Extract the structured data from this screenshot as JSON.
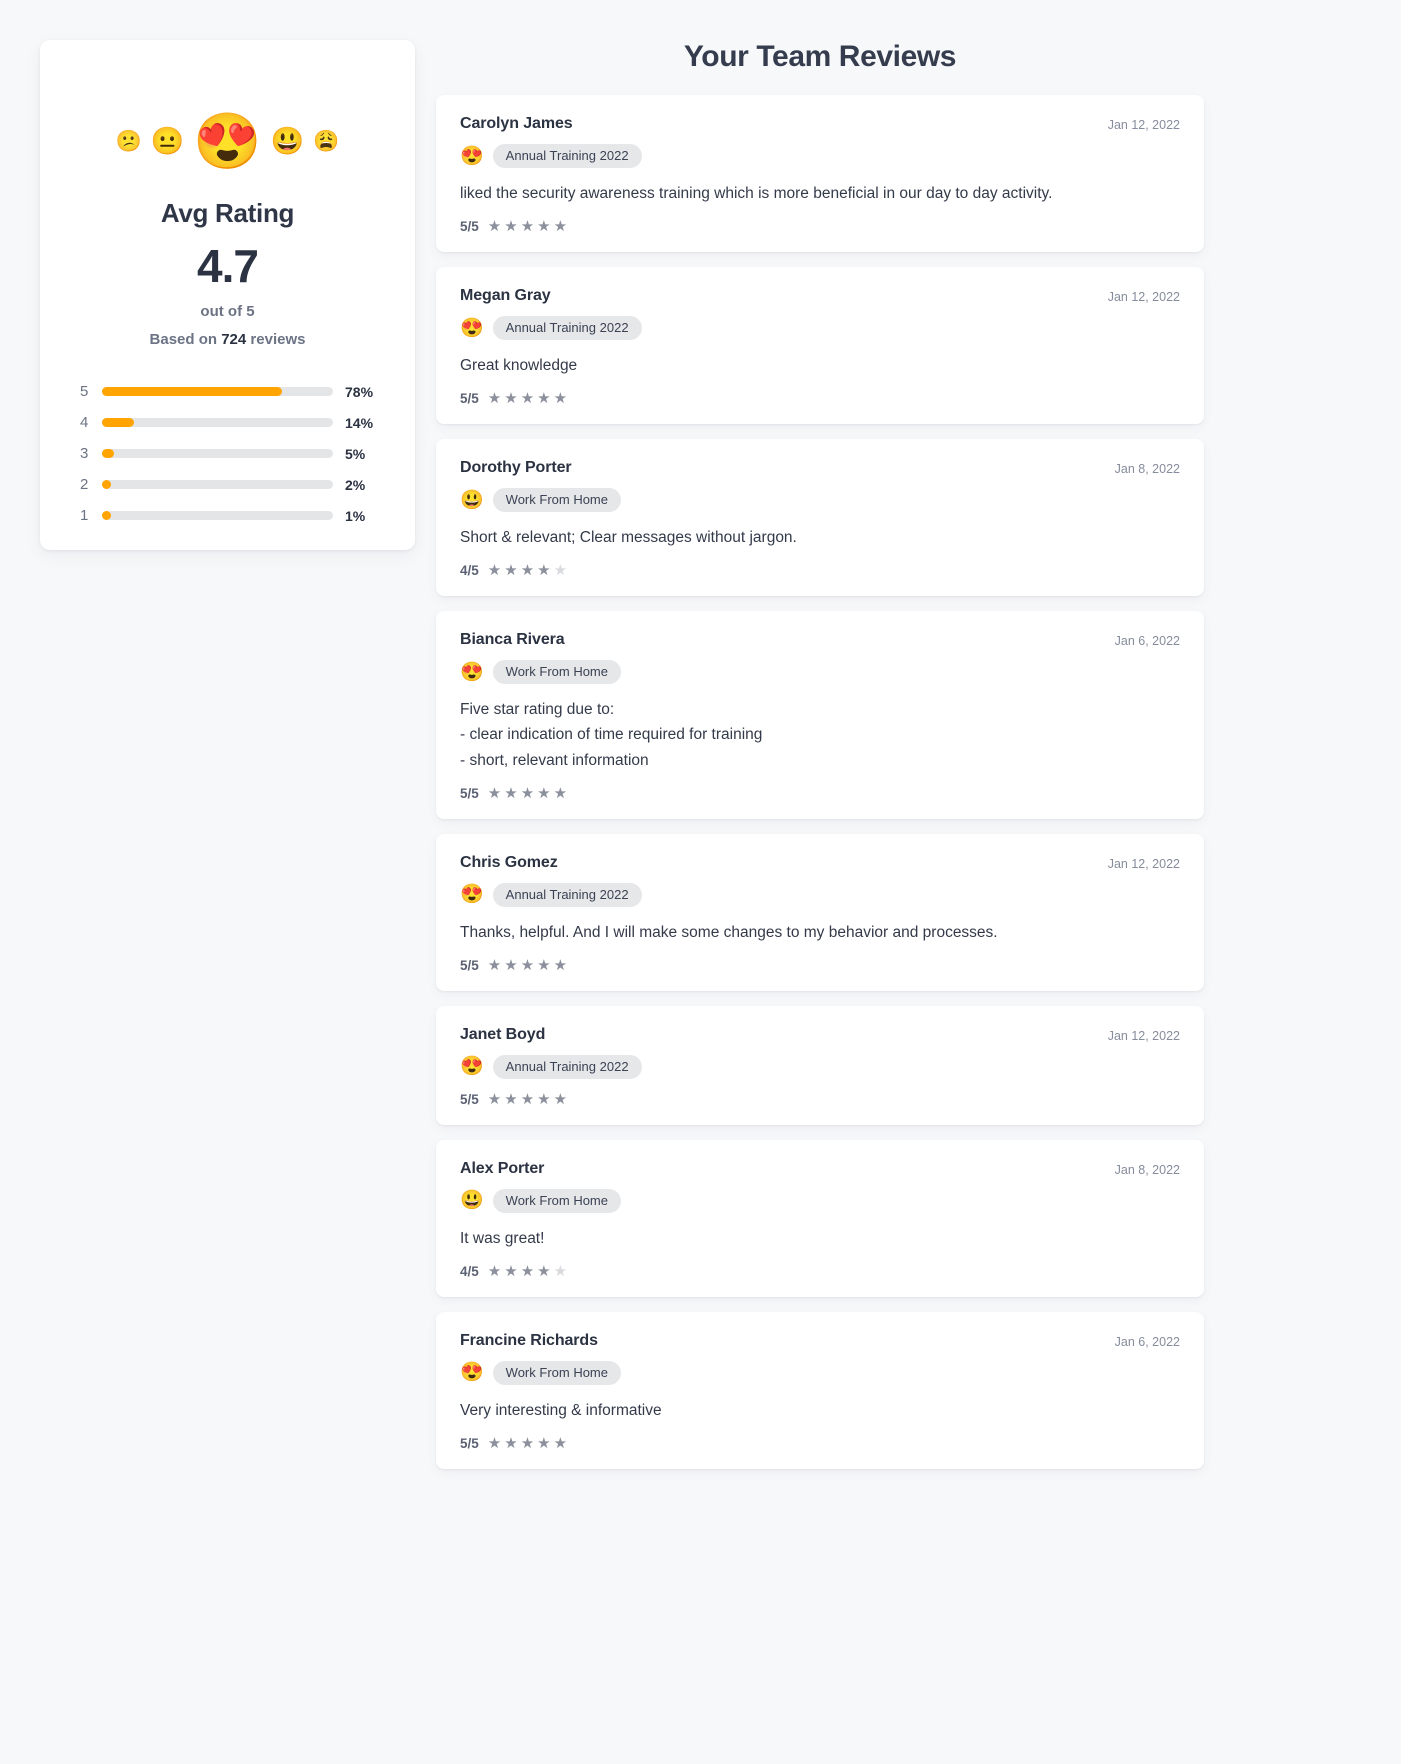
{
  "summary": {
    "emoji_row": [
      {
        "name": "confused-face-emoji",
        "glyph": "😕",
        "size": "small"
      },
      {
        "name": "neutral-face-emoji",
        "glyph": "😐",
        "size": "medium"
      },
      {
        "name": "heart-eyes-emoji",
        "glyph": "😍",
        "size": "large"
      },
      {
        "name": "slightly-smiling-face-emoji",
        "glyph": "😃",
        "size": "medium"
      },
      {
        "name": "weary-face-emoji",
        "glyph": "😩",
        "size": "small"
      }
    ],
    "title": "Avg Rating",
    "value": "4.7",
    "out_of": "out of 5",
    "based_on_prefix": "Based on ",
    "based_on_count": "724",
    "based_on_suffix": " reviews",
    "accent_color": "#ffa400",
    "track_color": "#e4e5e7",
    "distribution": [
      {
        "label": "5",
        "pct": 78,
        "pct_text": "78%"
      },
      {
        "label": "4",
        "pct": 14,
        "pct_text": "14%"
      },
      {
        "label": "3",
        "pct": 5,
        "pct_text": "5%"
      },
      {
        "label": "2",
        "pct": 2,
        "pct_text": "2%"
      },
      {
        "label": "1",
        "pct": 1,
        "pct_text": "1%"
      }
    ]
  },
  "header": {
    "title": "Your Team Reviews"
  },
  "reviews": [
    {
      "name": "Carolyn James",
      "date": "Jan 12, 2022",
      "emoji": "😍",
      "emoji_name": "heart-eyes-emoji",
      "tag": "Annual Training 2022",
      "body": "liked the security awareness training which is more beneficial in our day to day activity.",
      "score": "5/5",
      "stars_filled": 5,
      "stars_total": 5
    },
    {
      "name": "Megan Gray",
      "date": "Jan 12, 2022",
      "emoji": "😍",
      "emoji_name": "heart-eyes-emoji",
      "tag": "Annual Training 2022",
      "body": "Great knowledge",
      "score": "5/5",
      "stars_filled": 5,
      "stars_total": 5
    },
    {
      "name": "Dorothy Porter",
      "date": "Jan 8, 2022",
      "emoji": "😃",
      "emoji_name": "smiling-face-emoji",
      "tag": "Work From Home",
      "body": "Short & relevant; Clear messages without jargon.",
      "score": "4/5",
      "stars_filled": 4,
      "stars_total": 5
    },
    {
      "name": "Bianca Rivera",
      "date": "Jan 6, 2022",
      "emoji": "😍",
      "emoji_name": "heart-eyes-emoji",
      "tag": "Work From Home",
      "body": "Five star rating due to:\n- clear indication of time required for training\n- short, relevant information",
      "score": "5/5",
      "stars_filled": 5,
      "stars_total": 5
    },
    {
      "name": "Chris Gomez",
      "date": "Jan 12, 2022",
      "emoji": "😍",
      "emoji_name": "heart-eyes-emoji",
      "tag": "Annual Training 2022",
      "body": "Thanks, helpful. And I will make some changes to my behavior and processes.",
      "score": "5/5",
      "stars_filled": 5,
      "stars_total": 5
    },
    {
      "name": "Janet Boyd",
      "date": "Jan 12, 2022",
      "emoji": "😍",
      "emoji_name": "heart-eyes-emoji",
      "tag": "Annual Training 2022",
      "body": "",
      "score": "5/5",
      "stars_filled": 5,
      "stars_total": 5
    },
    {
      "name": "Alex Porter",
      "date": "Jan 8, 2022",
      "emoji": "😃",
      "emoji_name": "smiling-face-emoji",
      "tag": "Work From Home",
      "body": "It was great!",
      "score": "4/5",
      "stars_filled": 4,
      "stars_total": 5
    },
    {
      "name": "Francine Richards",
      "date": "Jan 6, 2022",
      "emoji": "😍",
      "emoji_name": "heart-eyes-emoji",
      "tag": "Work From Home",
      "body": "Very interesting & informative",
      "score": "5/5",
      "stars_filled": 5,
      "stars_total": 5
    }
  ],
  "icons": {
    "star_filled": "★",
    "star_empty": "★"
  }
}
